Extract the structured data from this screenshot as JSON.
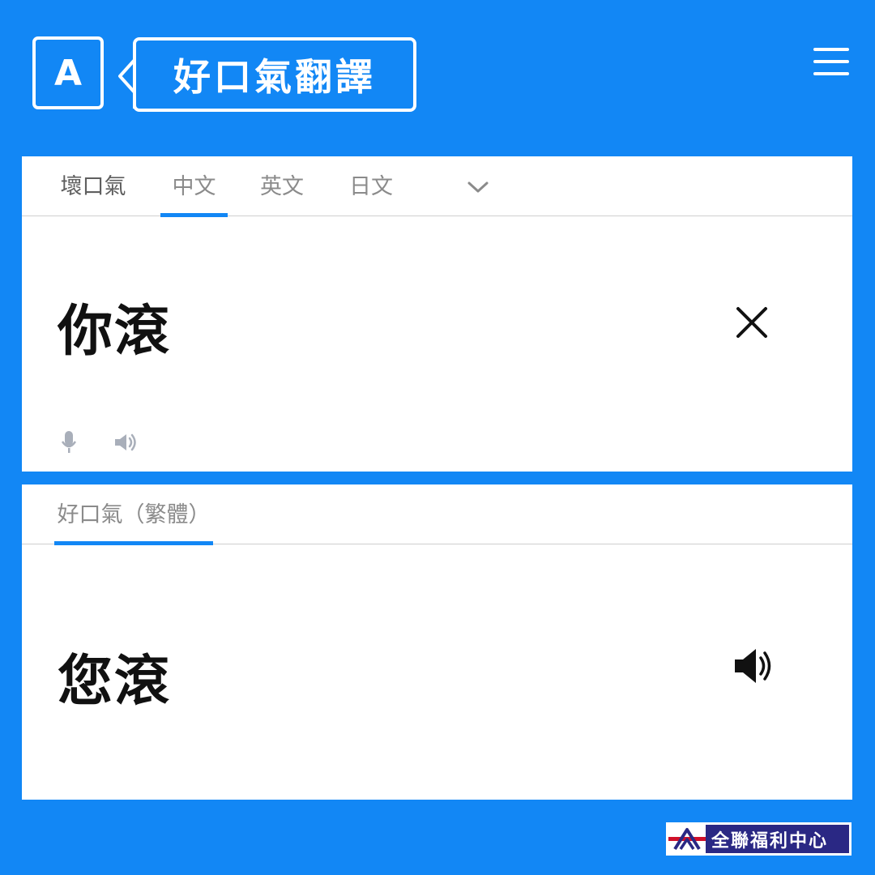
{
  "app": {
    "logo_letter": "A",
    "title": "好口氣翻譯"
  },
  "input_panel": {
    "tabs": [
      {
        "label": "壞口氣",
        "selected": false
      },
      {
        "label": "中文",
        "selected": true
      },
      {
        "label": "英文",
        "selected": false
      },
      {
        "label": "日文",
        "selected": false
      }
    ],
    "source_text": "你滾"
  },
  "output_panel": {
    "tab_label": "好口氣（繁體）",
    "translated_text": "您滾"
  },
  "brand": {
    "name": "全聯福利中心"
  },
  "colors": {
    "accent": "#1287f5",
    "brand_navy": "#2a2884"
  },
  "icons": {
    "menu": "hamburger-menu-icon",
    "chevron": "chevron-down-icon",
    "clear": "close-icon",
    "mic": "microphone-icon",
    "speaker": "speaker-icon"
  }
}
